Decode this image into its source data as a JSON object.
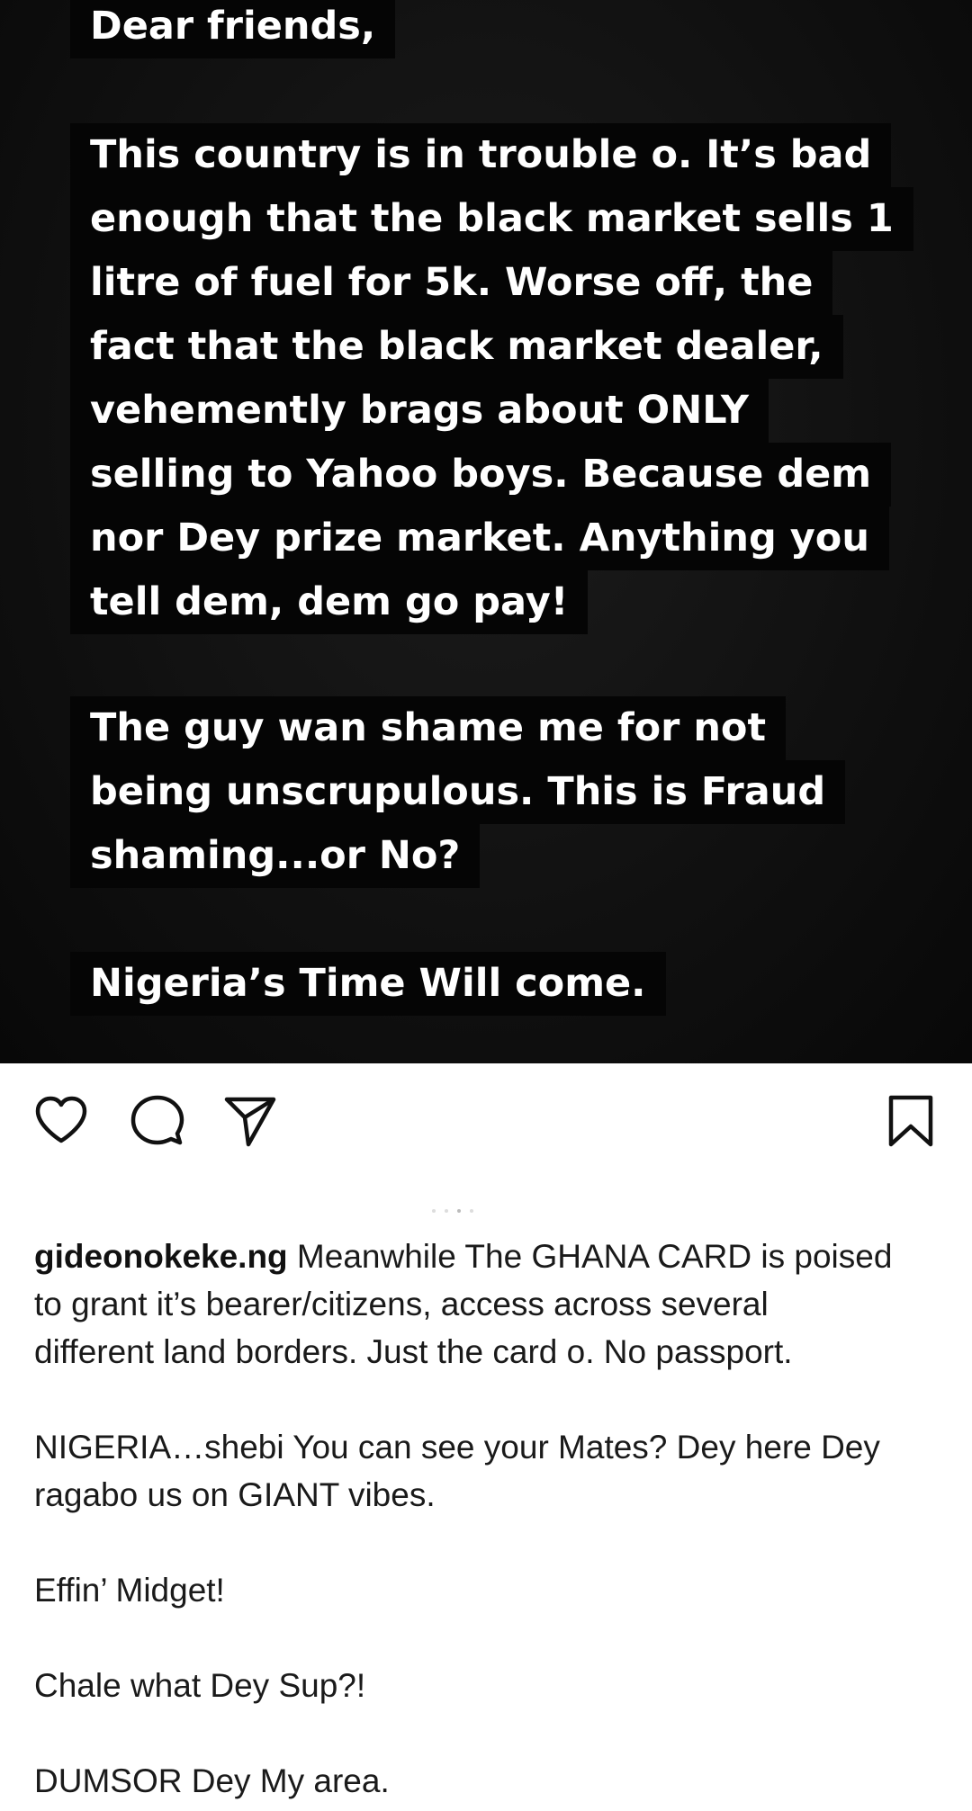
{
  "post": {
    "image_text": {
      "paragraphs": [
        [
          "Dear friends,"
        ],
        [
          "This country is in trouble o. It’s bad",
          "enough that the black market sells 1",
          "litre of fuel for 5k. Worse off, the",
          "fact that the black market dealer,",
          "vehemently brags about ONLY",
          "selling to Yahoo boys. Because dem",
          "nor Dey prize market. Anything you",
          "tell dem, dem go pay!"
        ],
        [
          "The guy wan shame me for not",
          "being unscrupulous. This is Fraud",
          "shaming...or No?"
        ],
        [
          "Nigeria’s Time Will come."
        ]
      ]
    },
    "actions": {
      "like_icon": "heart-outline-icon",
      "comment_icon": "speech-bubble-icon",
      "share_icon": "paper-plane-icon",
      "save_icon": "bookmark-outline-icon"
    },
    "caption": {
      "username": "gideonokeke.ng",
      "first_line_rest": " Meanwhile The GHANA CARD is poised",
      "line2": "to grant it’s bearer/citizens,  access across several",
      "line3": "different land borders. Just the card o. No passport.",
      "line4": "NIGERIA…shebi You can see your Mates? Dey here Dey",
      "line5": "ragabo us on GIANT vibes.",
      "line6": "Effin’ Midget!",
      "line7": "Chale what Dey Sup?!",
      "line8": "DUMSOR Dey My area."
    }
  }
}
